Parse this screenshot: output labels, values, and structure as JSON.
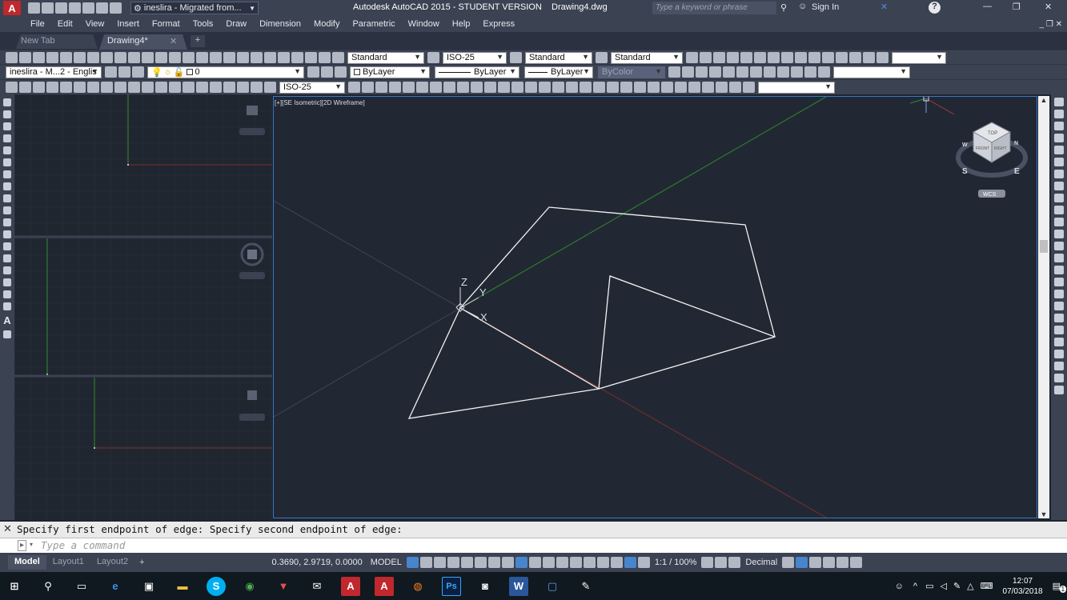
{
  "titlebar": {
    "workspace": "ineslira - Migrated from...",
    "title": "Autodesk AutoCAD 2015 - STUDENT VERSION    Drawing4.dwg",
    "search_placeholder": "Type a keyword or phrase",
    "sign_in": "Sign In"
  },
  "menu": [
    "File",
    "Edit",
    "View",
    "Insert",
    "Format",
    "Tools",
    "Draw",
    "Dimension",
    "Modify",
    "Parametric",
    "Window",
    "Help",
    "Express"
  ],
  "tabs": [
    {
      "label": "New Tab"
    },
    {
      "label": "Drawing4*"
    }
  ],
  "tab_add": "+",
  "styles": {
    "text_style": "Standard",
    "dim_style": "ISO-25",
    "table_style": "Standard",
    "mleader_style": "Standard",
    "layer_set": "ineslira - M...2 - Englis",
    "layer": "0",
    "color": "ByLayer",
    "linetype": "ByLayer",
    "lineweight": "ByLayer",
    "plotstyle": "ByColor",
    "dim_style_2": "ISO-25"
  },
  "viewport": {
    "label": "[+][SE Isometric][2D Wireframe]",
    "axis_z": "Z",
    "axis_y": "Y",
    "axis_x": "X",
    "viewcube_top": "TOP",
    "viewcube_front": "FRONT",
    "viewcube_right": "RIGHT",
    "compass_s": "S",
    "compass_e": "E",
    "compass_w": "W",
    "compass_n": "N",
    "wcs": "WCS"
  },
  "command": {
    "history": "Specify first endpoint of edge: Specify second endpoint of edge:",
    "placeholder": "Type a command"
  },
  "layout_tabs": [
    "Model",
    "Layout1",
    "Layout2"
  ],
  "layout_add": "+",
  "status": {
    "coords": "0.3690, 2.9719, 0.0000",
    "space": "MODEL",
    "scale": "1:1 / 100%",
    "units": "Decimal"
  },
  "taskbar": {
    "time": "12:07",
    "date": "07/03/2018",
    "notification_count": "1"
  },
  "colors": {
    "viewport_bg": "#222833",
    "ui_panel": "#3b4252",
    "x_axis": "#a03a3a",
    "y_axis": "#2e8b2e",
    "geometry": "#f2f2f2",
    "viewport_border": "#3878c8"
  }
}
